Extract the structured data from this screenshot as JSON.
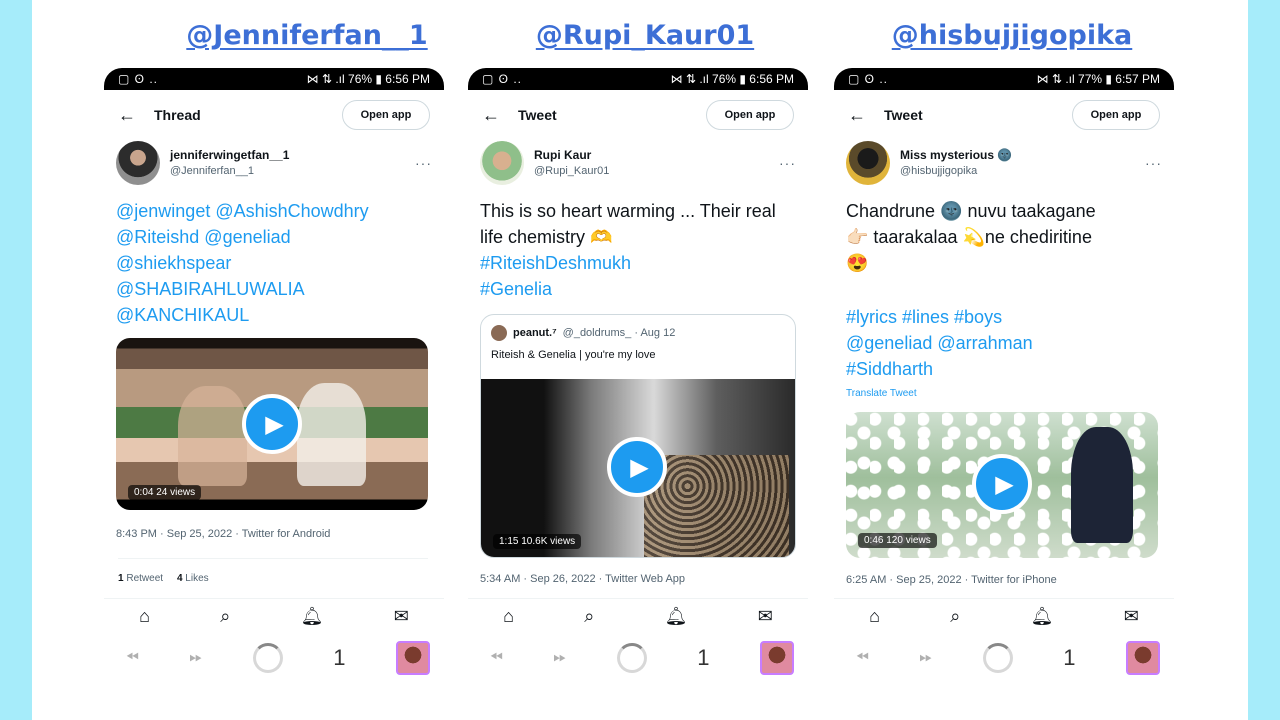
{
  "handles": [
    "@Jenniferfan__1",
    "@Rupi_Kaur01",
    "@hisbujjigopika"
  ],
  "phones": [
    {
      "status_left": "▢ ʘ ..",
      "status_right": "⋈ ⇅ .ıl 76% ▮ 6:56 PM",
      "topbar_title": "Thread",
      "open_app": "Open app",
      "display_name": "jenniferwingetfan__1",
      "username": "@Jenniferfan__1",
      "text_lines": [
        "@jenwinget @AshishChowdhry",
        "@Riteishd @geneliad",
        "@shiekhspear",
        "@SHABIRAHLUWALIA",
        "@KANCHIKAUL"
      ],
      "video_duration": "0:04",
      "video_views": "24 views",
      "meta": "8:43 PM · Sep 25, 2022 · Twitter for Android",
      "retweets": "1",
      "retweets_label": "Retweet",
      "likes": "4",
      "likes_label": "Likes",
      "page_number": "1"
    },
    {
      "status_left": "▢ ʘ ..",
      "status_right": "⋈ ⇅ .ıl 76% ▮ 6:56 PM",
      "topbar_title": "Tweet",
      "open_app": "Open app",
      "display_name": "Rupi Kaur",
      "username": "@Rupi_Kaur01",
      "text_plain": "This is so heart warming ... Their real life chemistry 🫶",
      "text_links": [
        "#RiteishDeshmukh",
        "#Genelia"
      ],
      "quote_name": "peanut.⁷",
      "quote_handle": "@_doldrums_ · Aug 12",
      "quote_text": "Riteish & Genelia | you're my love",
      "video_duration": "1:15",
      "video_views": "10.6K views",
      "meta": "5:34 AM · Sep 26, 2022 · Twitter Web App",
      "page_number": "1"
    },
    {
      "status_left": "▢ ʘ ..",
      "status_right": "⋈ ⇅ .ıl 77% ▮ 6:57 PM",
      "topbar_title": "Tweet",
      "open_app": "Open app",
      "display_name": "Miss mysterious 🌚",
      "username": "@hisbujjigopika",
      "text_plain_lines": [
        "Chandrune 🌚 nuvu taakagane",
        "👉🏻 taarakalaa 💫ne chediritine",
        "😍"
      ],
      "text_links": [
        "#lyrics #lines #boys",
        "@geneliad @arrahman",
        "#Siddharth"
      ],
      "translate": "Translate Tweet",
      "video_duration": "0:46",
      "video_views": "120 views",
      "meta": "6:25 AM · Sep 25, 2022 · Twitter for iPhone",
      "page_number": "1"
    }
  ],
  "icons": {
    "back": "arrow-left-icon",
    "home": "home-icon",
    "search": "search-icon",
    "notifications": "bell-icon",
    "messages": "mail-icon",
    "play": "play-icon"
  },
  "colors": {
    "background": "#a6ecfa",
    "handle": "#3d6fd6",
    "link": "#1d9bf0"
  }
}
